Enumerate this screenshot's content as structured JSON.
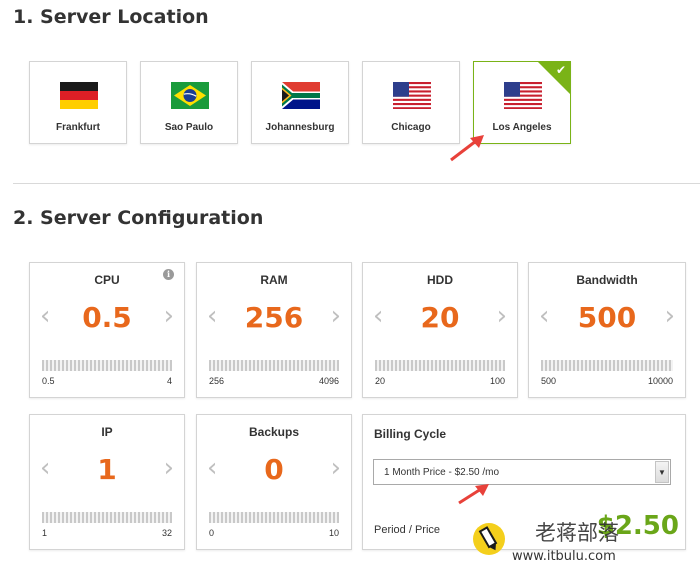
{
  "section1": {
    "title": "1. Server Location"
  },
  "section2": {
    "title": "2. Server Configuration"
  },
  "locations": [
    {
      "name": "Frankfurt",
      "flag": "germany-flag",
      "selected": false
    },
    {
      "name": "Sao Paulo",
      "flag": "brazil-flag",
      "selected": false
    },
    {
      "name": "Johannesburg",
      "flag": "south-africa-flag",
      "selected": false
    },
    {
      "name": "Chicago",
      "flag": "usa-flag",
      "selected": false
    },
    {
      "name": "Los Angeles",
      "flag": "usa-flag",
      "selected": true
    }
  ],
  "config": {
    "cpu": {
      "label": "CPU",
      "value": "0.5",
      "min": "0.5",
      "max": "4"
    },
    "ram": {
      "label": "RAM",
      "value": "256",
      "min": "256",
      "max": "4096"
    },
    "hdd": {
      "label": "HDD",
      "value": "20",
      "min": "20",
      "max": "100"
    },
    "bandwidth": {
      "label": "Bandwidth",
      "value": "500",
      "min": "500",
      "max": "10000"
    },
    "ip": {
      "label": "IP",
      "value": "1",
      "min": "1",
      "max": "32"
    },
    "backups": {
      "label": "Backups",
      "value": "0",
      "min": "0",
      "max": "10"
    }
  },
  "billing": {
    "title": "Billing Cycle",
    "selected": "1 Month Price - $2.50 /mo",
    "period_label": "Period / Price",
    "price": "$2.50"
  },
  "icons": {
    "chevron_left": "‹",
    "chevron_right": "›",
    "info": "i",
    "check": "✔",
    "dropdown": "▼"
  },
  "colors": {
    "accent_orange": "#e8681c",
    "selected_green": "#7ab317",
    "price_green": "#6aa619",
    "arrow_red": "#e8413a"
  },
  "watermark": {
    "cn": "老蒋部落",
    "url": "www.itbulu.com"
  }
}
